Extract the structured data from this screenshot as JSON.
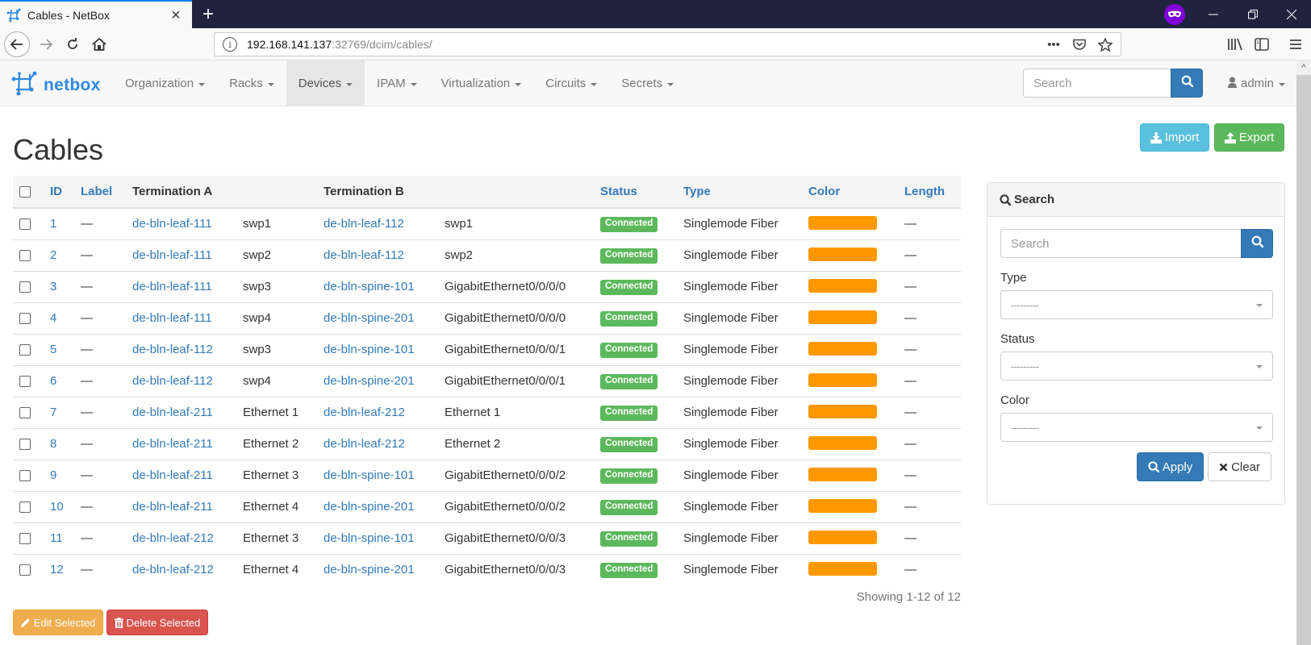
{
  "browser": {
    "tab_title": "Cables - NetBox",
    "url_host": "192.168.141.137",
    "url_rest": ":32769/dcim/cables/",
    "new_tab_label": "+",
    "icons": [
      "netbox-favicon-icon",
      "close-icon",
      "private-browsing-icon",
      "minimize-icon",
      "restore-icon",
      "window-close-icon",
      "back-icon",
      "forward-icon",
      "reload-icon",
      "home-icon",
      "info-icon",
      "more-icon",
      "pocket-icon",
      "bookmark-star-icon",
      "library-icon",
      "sidebar-icon",
      "hamburger-menu-icon"
    ]
  },
  "nav": {
    "brand": "netbox",
    "menu": [
      {
        "label": "Organization",
        "active": false
      },
      {
        "label": "Racks",
        "active": false
      },
      {
        "label": "Devices",
        "active": true
      },
      {
        "label": "IPAM",
        "active": false
      },
      {
        "label": "Virtualization",
        "active": false
      },
      {
        "label": "Circuits",
        "active": false
      },
      {
        "label": "Secrets",
        "active": false
      }
    ],
    "search_placeholder": "Search",
    "user": "admin"
  },
  "page": {
    "title": "Cables",
    "import_label": "Import",
    "export_label": "Export"
  },
  "table": {
    "columns": [
      "ID",
      "Label",
      "Termination A",
      "",
      "Termination B",
      "",
      "Status",
      "Type",
      "Color",
      "Length"
    ],
    "rows": [
      {
        "id": "1",
        "label": "—",
        "device_a": "de-bln-leaf-111",
        "port_a": "swp1",
        "device_b": "de-bln-leaf-112",
        "port_b": "swp1",
        "status": "Connected",
        "type": "Singlemode Fiber",
        "color": "#ff9800",
        "length": "—"
      },
      {
        "id": "2",
        "label": "—",
        "device_a": "de-bln-leaf-111",
        "port_a": "swp2",
        "device_b": "de-bln-leaf-112",
        "port_b": "swp2",
        "status": "Connected",
        "type": "Singlemode Fiber",
        "color": "#ff9800",
        "length": "—"
      },
      {
        "id": "3",
        "label": "—",
        "device_a": "de-bln-leaf-111",
        "port_a": "swp3",
        "device_b": "de-bln-spine-101",
        "port_b": "GigabitEthernet0/0/0/0",
        "status": "Connected",
        "type": "Singlemode Fiber",
        "color": "#ff9800",
        "length": "—"
      },
      {
        "id": "4",
        "label": "—",
        "device_a": "de-bln-leaf-111",
        "port_a": "swp4",
        "device_b": "de-bln-spine-201",
        "port_b": "GigabitEthernet0/0/0/0",
        "status": "Connected",
        "type": "Singlemode Fiber",
        "color": "#ff9800",
        "length": "—"
      },
      {
        "id": "5",
        "label": "—",
        "device_a": "de-bln-leaf-112",
        "port_a": "swp3",
        "device_b": "de-bln-spine-101",
        "port_b": "GigabitEthernet0/0/0/1",
        "status": "Connected",
        "type": "Singlemode Fiber",
        "color": "#ff9800",
        "length": "—"
      },
      {
        "id": "6",
        "label": "—",
        "device_a": "de-bln-leaf-112",
        "port_a": "swp4",
        "device_b": "de-bln-spine-201",
        "port_b": "GigabitEthernet0/0/0/1",
        "status": "Connected",
        "type": "Singlemode Fiber",
        "color": "#ff9800",
        "length": "—"
      },
      {
        "id": "7",
        "label": "—",
        "device_a": "de-bln-leaf-211",
        "port_a": "Ethernet 1",
        "device_b": "de-bln-leaf-212",
        "port_b": "Ethernet 1",
        "status": "Connected",
        "type": "Singlemode Fiber",
        "color": "#ff9800",
        "length": "—"
      },
      {
        "id": "8",
        "label": "—",
        "device_a": "de-bln-leaf-211",
        "port_a": "Ethernet 2",
        "device_b": "de-bln-leaf-212",
        "port_b": "Ethernet 2",
        "status": "Connected",
        "type": "Singlemode Fiber",
        "color": "#ff9800",
        "length": "—"
      },
      {
        "id": "9",
        "label": "—",
        "device_a": "de-bln-leaf-211",
        "port_a": "Ethernet 3",
        "device_b": "de-bln-spine-101",
        "port_b": "GigabitEthernet0/0/0/2",
        "status": "Connected",
        "type": "Singlemode Fiber",
        "color": "#ff9800",
        "length": "—"
      },
      {
        "id": "10",
        "label": "—",
        "device_a": "de-bln-leaf-211",
        "port_a": "Ethernet 4",
        "device_b": "de-bln-spine-201",
        "port_b": "GigabitEthernet0/0/0/2",
        "status": "Connected",
        "type": "Singlemode Fiber",
        "color": "#ff9800",
        "length": "—"
      },
      {
        "id": "11",
        "label": "—",
        "device_a": "de-bln-leaf-212",
        "port_a": "Ethernet 3",
        "device_b": "de-bln-spine-101",
        "port_b": "GigabitEthernet0/0/0/3",
        "status": "Connected",
        "type": "Singlemode Fiber",
        "color": "#ff9800",
        "length": "—"
      },
      {
        "id": "12",
        "label": "—",
        "device_a": "de-bln-leaf-212",
        "port_a": "Ethernet 4",
        "device_b": "de-bln-spine-201",
        "port_b": "GigabitEthernet0/0/0/3",
        "status": "Connected",
        "type": "Singlemode Fiber",
        "color": "#ff9800",
        "length": "—"
      }
    ],
    "edit_selected_label": "Edit Selected",
    "delete_selected_label": "Delete Selected",
    "showing": "Showing 1-12 of 12"
  },
  "filter": {
    "heading": "Search",
    "search_placeholder": "Search",
    "type_label": "Type",
    "type_value": "---------",
    "status_label": "Status",
    "status_value": "---------",
    "color_label": "Color",
    "color_value": "---------",
    "apply_label": "Apply",
    "clear_label": "Clear"
  },
  "colors": {
    "primary": "#337ab7",
    "success": "#5cb85c",
    "info": "#5bc0de",
    "warning": "#f0ad4e",
    "danger": "#d9534f",
    "brand": "#2f8ae4"
  }
}
